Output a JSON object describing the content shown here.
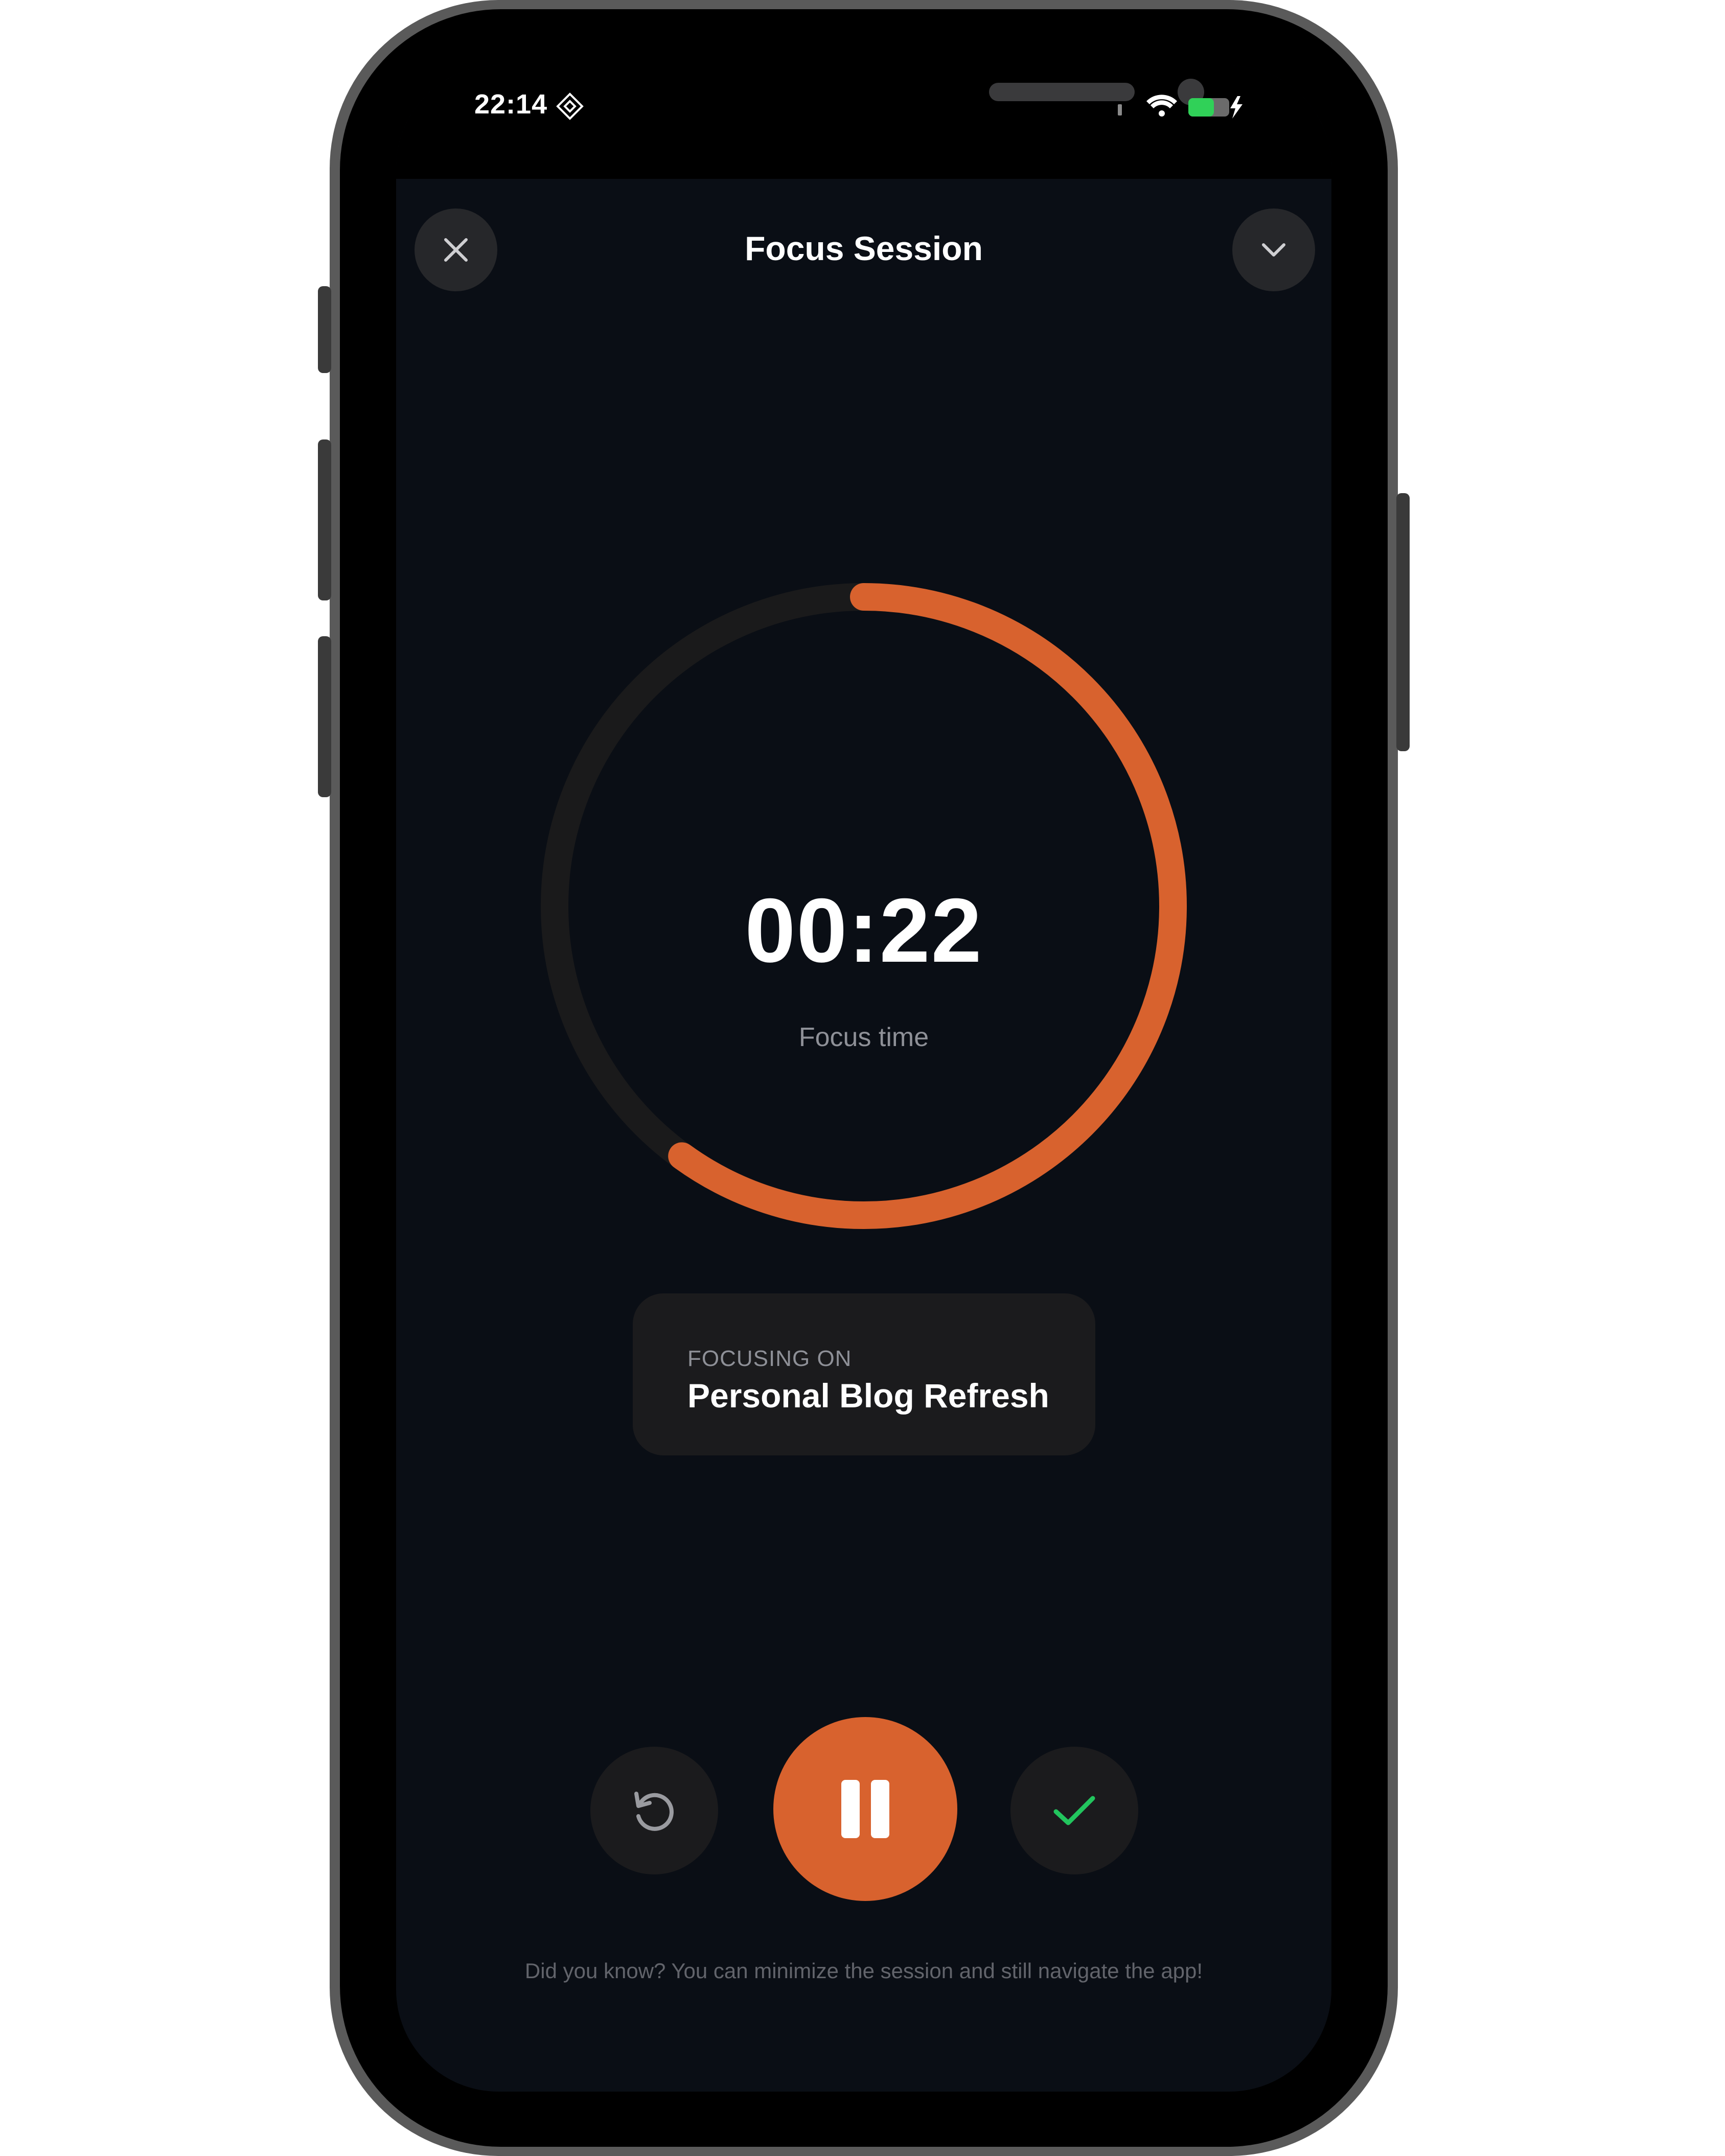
{
  "status_bar": {
    "time": "22:14",
    "battery_color": "#30d158"
  },
  "header": {
    "title": "Focus Session"
  },
  "timer": {
    "value": "00:22",
    "caption": "Focus time",
    "progress_fraction": 0.6,
    "accent_color": "#d8622e",
    "track_color": "#1a1a1b"
  },
  "focus_card": {
    "label": "FOCUSING ON",
    "title": "Personal Blog Refresh"
  },
  "controls": {
    "reset_icon": "restart-icon",
    "pause_icon": "pause-icon",
    "complete_icon": "check-icon",
    "complete_color": "#22c55e"
  },
  "hint": "Did you know? You can minimize the session and still navigate the app!"
}
